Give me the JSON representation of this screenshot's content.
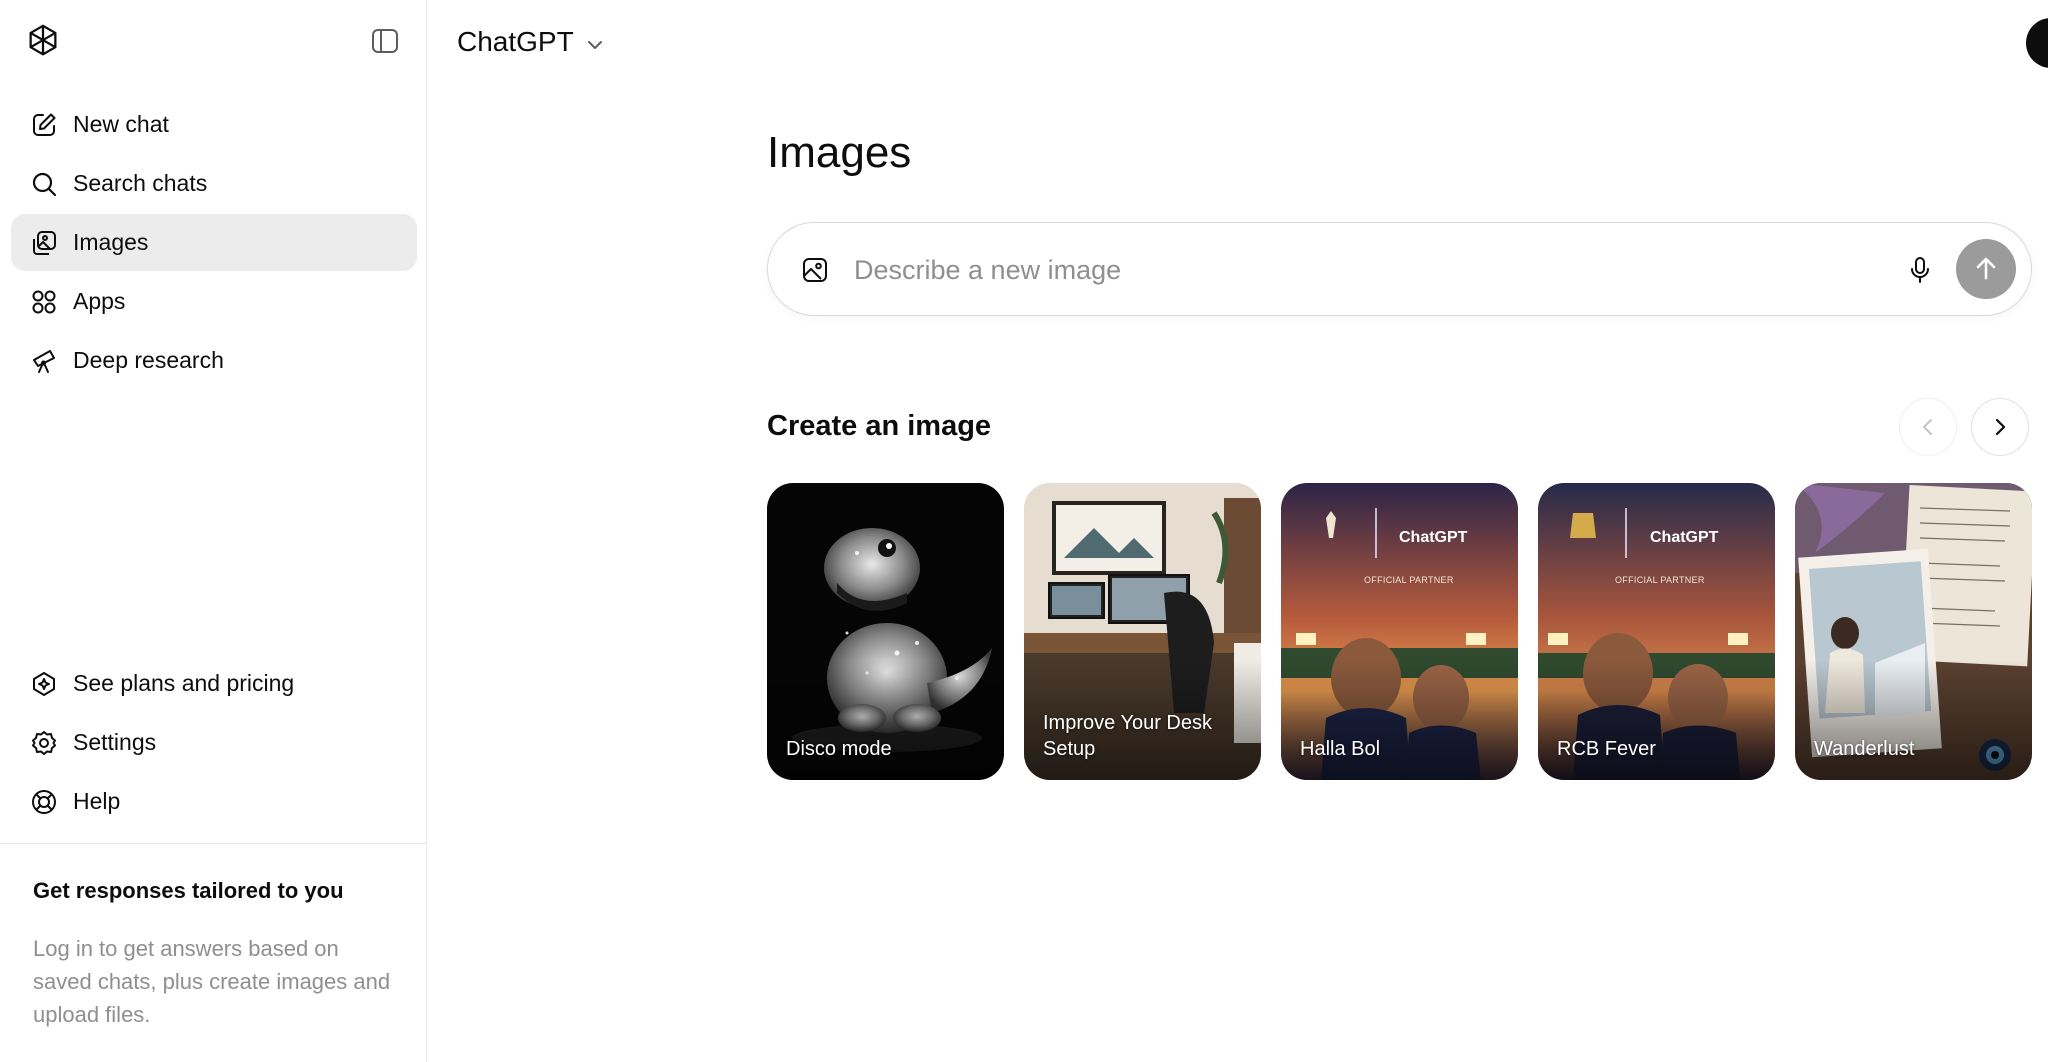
{
  "sidebar": {
    "items": [
      {
        "label": "New chat",
        "icon": "edit-icon"
      },
      {
        "label": "Search chats",
        "icon": "search-icon"
      },
      {
        "label": "Images",
        "icon": "images-icon",
        "active": true
      },
      {
        "label": "Apps",
        "icon": "apps-icon"
      },
      {
        "label": "Deep research",
        "icon": "telescope-icon"
      }
    ],
    "bottom_items": [
      {
        "label": "See plans and pricing",
        "icon": "plans-icon"
      },
      {
        "label": "Settings",
        "icon": "gear-icon"
      },
      {
        "label": "Help",
        "icon": "lifebuoy-icon"
      }
    ],
    "promo": {
      "title": "Get responses tailored to you",
      "text": "Log in to get answers based on saved chats, plus create images and upload files."
    }
  },
  "header": {
    "title": "ChatGPT"
  },
  "main": {
    "title": "Images",
    "prompt": {
      "placeholder": "Describe a new image",
      "value": ""
    },
    "section_title": "Create an image",
    "cards": [
      {
        "label": "Disco mode"
      },
      {
        "label": "Improve Your Desk Setup"
      },
      {
        "label": "Halla Bol",
        "brand_text": "ChatGPT",
        "tag": "OFFICIAL PARTNER"
      },
      {
        "label": "RCB Fever",
        "brand_text": "ChatGPT",
        "tag": "OFFICIAL PARTNER"
      },
      {
        "label": "Wanderlust"
      }
    ]
  },
  "colors": {
    "active_bg": "#ececec",
    "text": "#0d0d0d",
    "muted": "#8f8f8f",
    "send_button": "#9b9b9b"
  }
}
